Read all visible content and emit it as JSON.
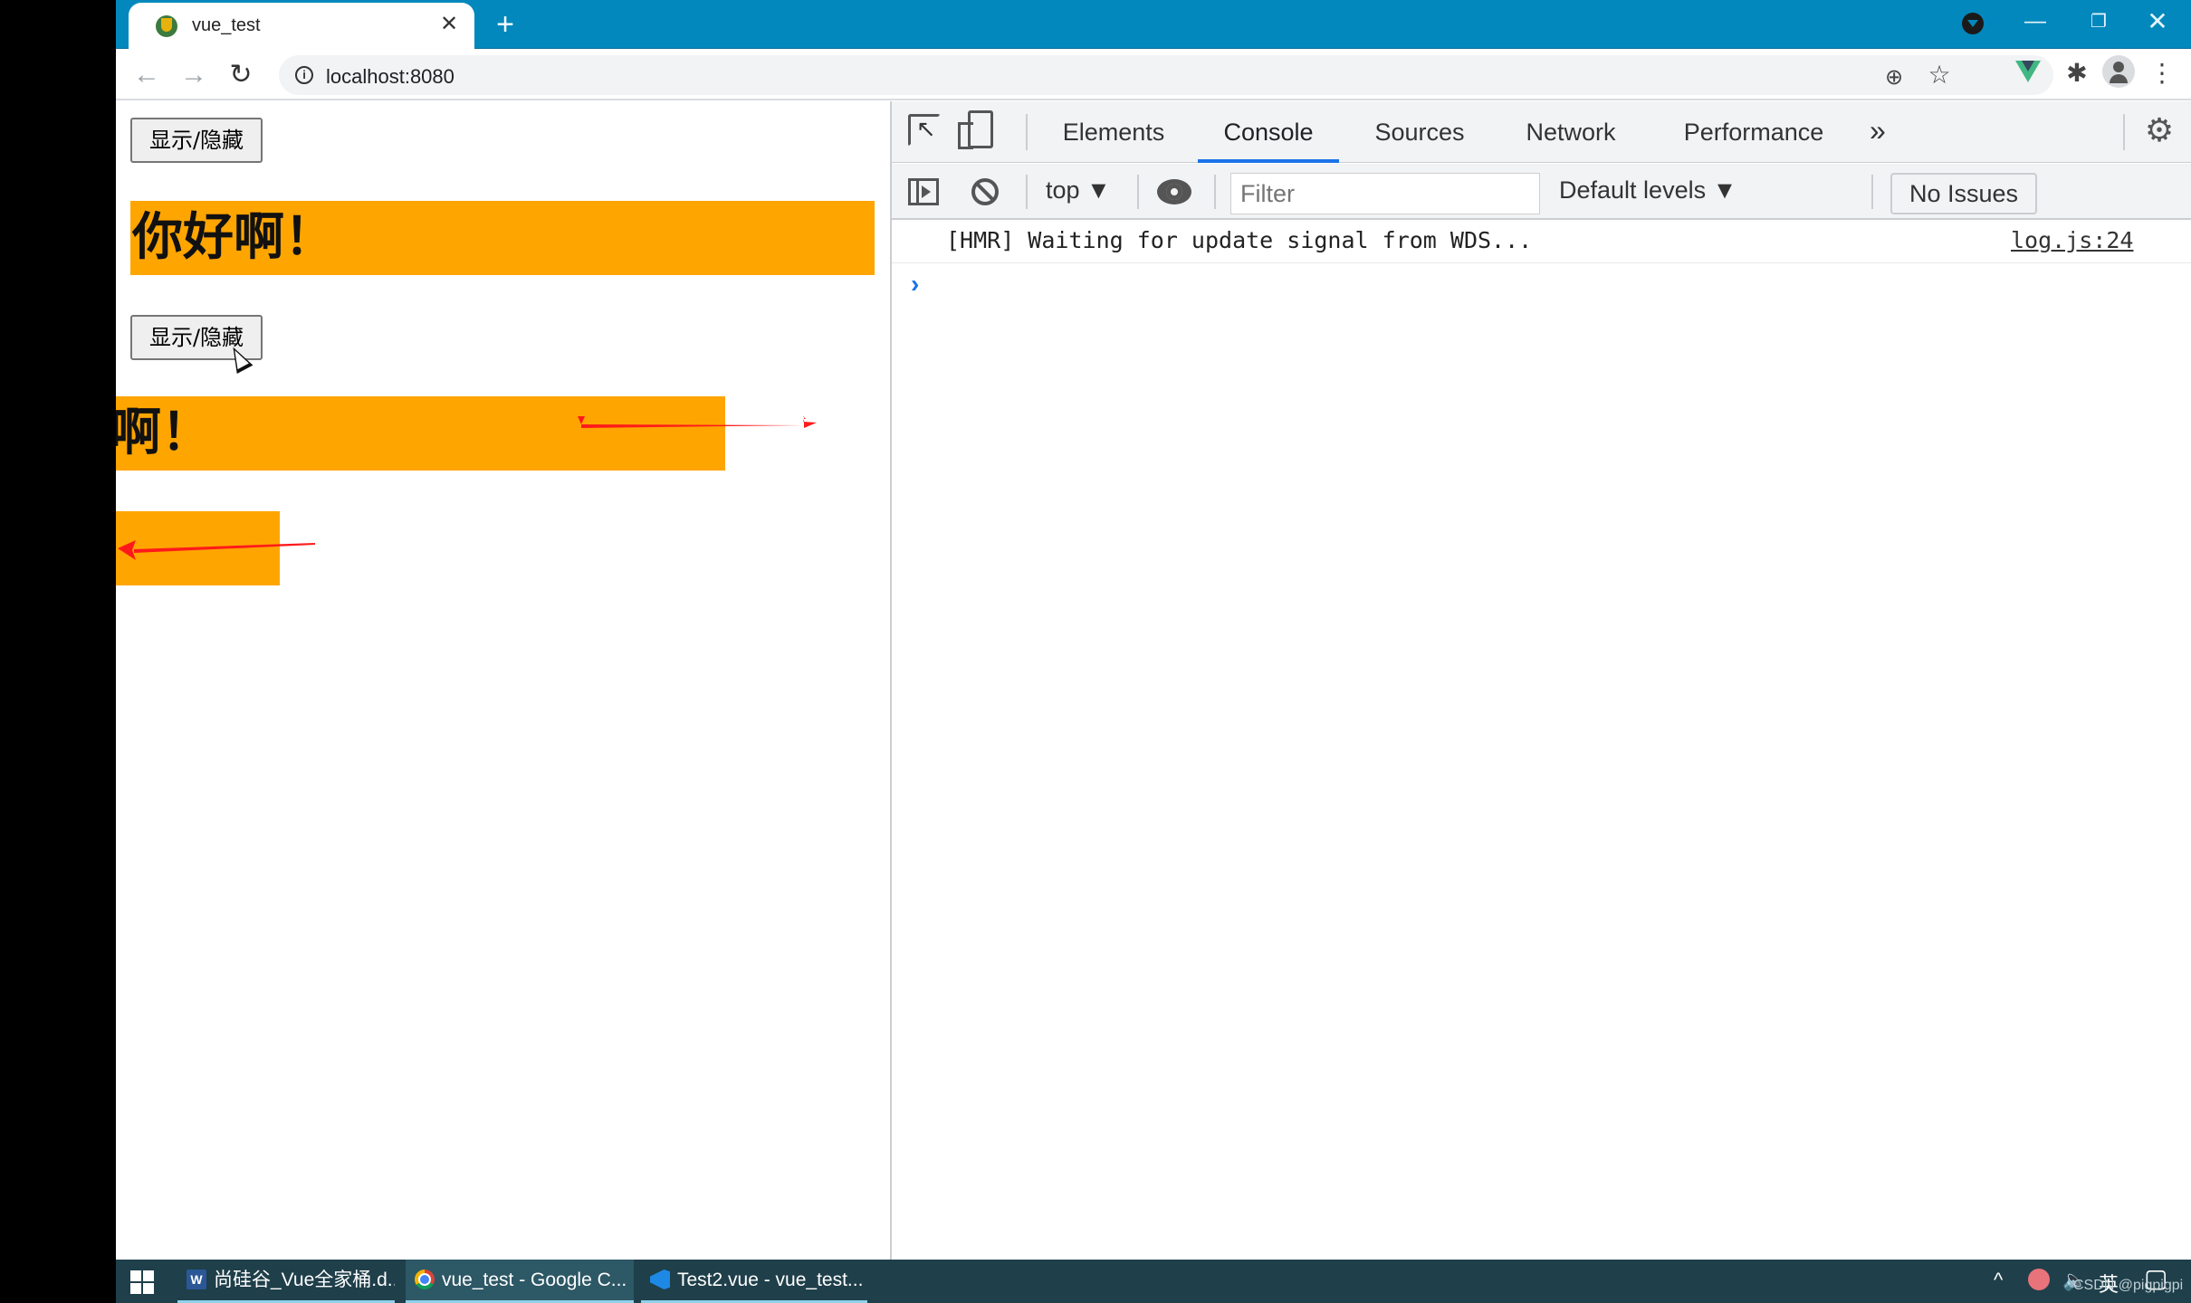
{
  "browser": {
    "tab": {
      "title": "vue_test",
      "close_glyph": "✕",
      "favicon": "vue-cli-favicon"
    },
    "new_tab_glyph": "+",
    "window_controls": {
      "minimize": "—",
      "maximize": "❐",
      "close": "✕"
    },
    "nav": {
      "back": "←",
      "forward": "→",
      "reload": "↻"
    },
    "omnibox": {
      "url": "localhost:8080",
      "info_glyph": "i"
    },
    "toolbar_icons": {
      "zoom": "⊕",
      "bookmark": "☆",
      "extensions": "✱",
      "menu": "⋮"
    }
  },
  "page": {
    "buttons": [
      {
        "label": "显示/隐藏"
      },
      {
        "label": "显示/隐藏"
      }
    ],
    "headings": [
      {
        "text": "你好啊！"
      },
      {
        "text": "你好啊！"
      },
      {
        "text": ""
      }
    ],
    "accent_color": "#ffa500",
    "annotation_color": "#ff1a1a"
  },
  "devtools": {
    "tabs": [
      {
        "label": "Elements",
        "active": false
      },
      {
        "label": "Console",
        "active": true
      },
      {
        "label": "Sources",
        "active": false
      },
      {
        "label": "Network",
        "active": false
      },
      {
        "label": "Performance",
        "active": false
      }
    ],
    "more_tabs_glyph": "»",
    "settings_glyph": "⚙",
    "kebab_glyph": "⋮",
    "close_glyph": "✕",
    "console_bar": {
      "context": "top ▼",
      "filter_placeholder": "Filter",
      "levels": "Default levels ▼",
      "issues": "No Issues"
    },
    "log": {
      "message": "[HMR] Waiting for update signal from WDS...",
      "source": "log.js:24"
    },
    "prompt_glyph": "›",
    "accent_color": "#1a73e8"
  },
  "taskbar": {
    "items": [
      {
        "label": "尚硅谷_Vue全家桶.d...",
        "icon": "word-icon",
        "icon_text": "W",
        "active": false
      },
      {
        "label": "vue_test - Google C...",
        "icon": "chrome-icon",
        "active": true
      },
      {
        "label": "Test2.vue - vue_test...",
        "icon": "vscode-icon",
        "active": false
      }
    ],
    "tray": {
      "chevron": "^",
      "volume": "🔈",
      "ime": "英",
      "notification": "▢"
    },
    "watermark": "CSDN @pigpigpi"
  }
}
